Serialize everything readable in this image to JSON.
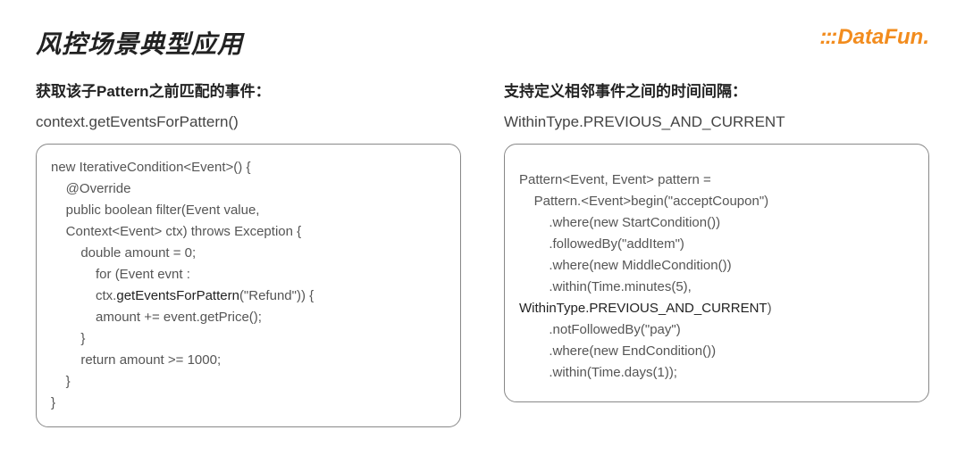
{
  "title": "风控场景典型应用",
  "logo": {
    "dots": ":::",
    "text": "DataFun."
  },
  "left": {
    "heading": "获取该子Pattern之前匹配的事件：",
    "api": "context.getEventsForPattern()",
    "code_lines": [
      {
        "t": "new IterativeCondition<Event>() {",
        "i": 0
      },
      {
        "t": "@Override",
        "i": 2
      },
      {
        "t": "public boolean filter(Event value,",
        "i": 2
      },
      {
        "t": "Context<Event> ctx) throws Exception {",
        "i": 2
      },
      {
        "t": "double amount = 0;",
        "i": 4
      },
      {
        "t": "for (Event evnt :",
        "i": 6
      },
      {
        "t_pre": "ctx.",
        "hl": "getEventsForPattern",
        "t_post": "(\"Refund\")) {",
        "i": 6
      },
      {
        "t": "amount += event.getPrice();",
        "i": 6
      },
      {
        "t": "}",
        "i": 4
      },
      {
        "t": "return amount >= 1000;",
        "i": 4
      },
      {
        "t": "}",
        "i": 2
      },
      {
        "t": "}",
        "i": 0
      }
    ]
  },
  "right": {
    "heading": "支持定义相邻事件之间的时间间隔：",
    "api": "WithinType.PREVIOUS_AND_CURRENT",
    "code_lines": [
      {
        "t": "Pattern<Event, Event> pattern =",
        "i": 0
      },
      {
        "t": "Pattern.<Event>begin(\"acceptCoupon\")",
        "i": 2
      },
      {
        "t": ".where(new StartCondition())",
        "i": 4
      },
      {
        "t": ".followedBy(\"addItem\")",
        "i": 4
      },
      {
        "t": ".where(new MiddleCondition())",
        "i": 4
      },
      {
        "t": ".within(Time.minutes(5),",
        "i": 4
      },
      {
        "hl": "WithinType.PREVIOUS_AND_CURRENT",
        "t_post": ")",
        "i": 0
      },
      {
        "t": ".notFollowedBy(\"pay\")",
        "i": 4
      },
      {
        "t": ".where(new EndCondition())",
        "i": 4
      },
      {
        "t": ".within(Time.days(1));",
        "i": 4
      }
    ]
  }
}
